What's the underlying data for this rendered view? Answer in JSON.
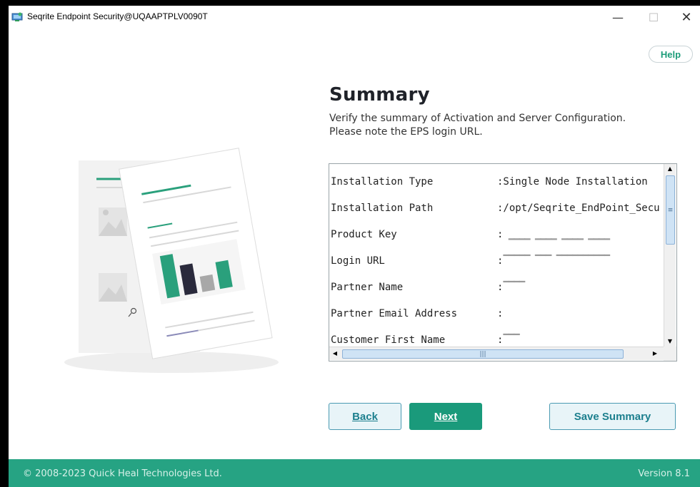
{
  "window": {
    "title": "Seqrite Endpoint Security@UQAAPTPLV0090T",
    "minimize_glyph": "—",
    "maximize_glyph": "☐",
    "close_glyph": "✕"
  },
  "help_label": "Help",
  "summary": {
    "title": "Summary",
    "subtitle_line1": "Verify the summary of Activation and Server Configuration.",
    "subtitle_line2": "Please note the EPS login URL.",
    "rows": [
      {
        "label": "Installation Type",
        "value": ":Single Node Installation"
      },
      {
        "label": "Installation Path",
        "value": ":/opt/Seqrite_EndPoint_Secu"
      },
      {
        "label": "Product Key",
        "value": ":"
      },
      {
        "label": "Login URL",
        "value": ":"
      },
      {
        "label": "Partner Name",
        "value": ":"
      },
      {
        "label": "Partner Email Address",
        "value": ":"
      },
      {
        "label": "Customer First Name",
        "value": ":"
      }
    ]
  },
  "buttons": {
    "back": "Back",
    "next": "Next",
    "save_summary": "Save Summary"
  },
  "footer": {
    "copyright": "© 2008-2023 Quick Heal Technologies Ltd.",
    "version": "Version 8.1"
  },
  "colors": {
    "accent": "#1a9a7b",
    "footer": "#26a383",
    "button_border": "#4a9ab2"
  },
  "icons": {
    "app": "seqrite-app-icon",
    "scroll_up": "▲",
    "scroll_down": "▼",
    "scroll_left": "◀",
    "scroll_right": "▶"
  }
}
